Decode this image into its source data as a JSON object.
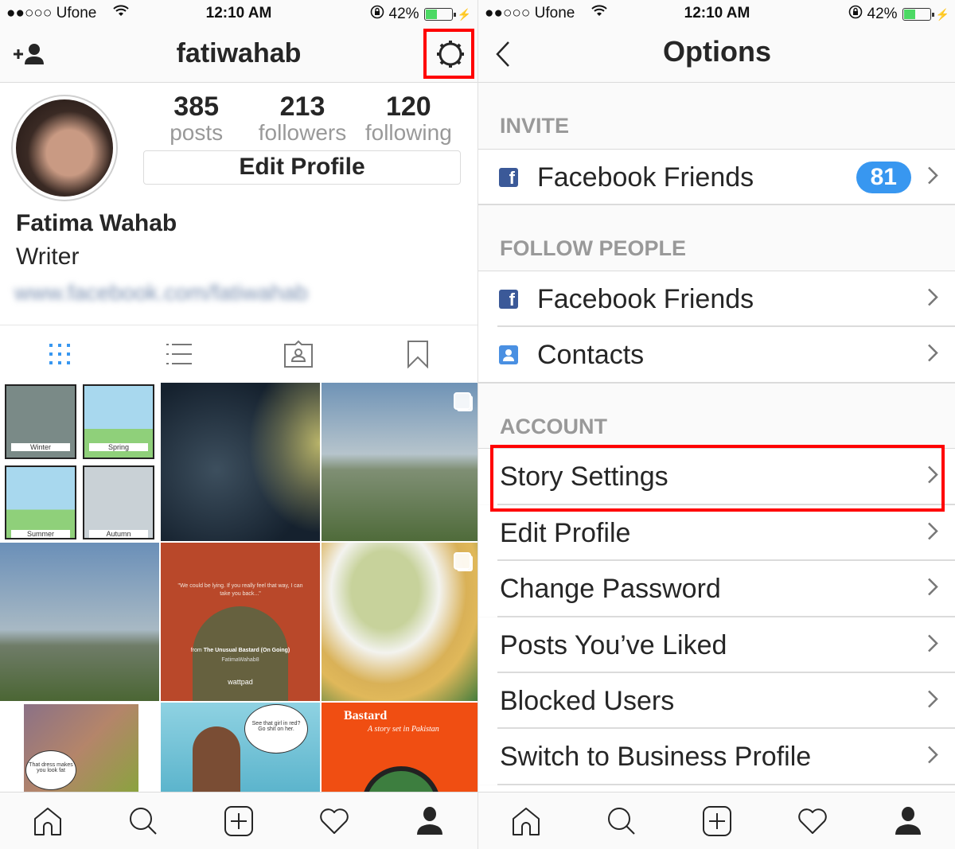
{
  "status_bar": {
    "carrier": "●●○○○ Ufone",
    "time": "12:10 AM",
    "battery": "42%"
  },
  "left": {
    "header": {
      "username": "fatiwahab",
      "add_user_icon": "add-person-icon",
      "settings_icon": "gear-icon"
    },
    "stats": [
      {
        "count": "385",
        "label": "posts"
      },
      {
        "count": "213",
        "label": "followers"
      },
      {
        "count": "120",
        "label": "following"
      }
    ],
    "edit_profile_label": "Edit Profile",
    "full_name": "Fatima Wahab",
    "bio": "Writer",
    "website": "www.facebook.com/fatiwahab",
    "view_tabs": [
      "grid-icon",
      "list-icon",
      "tagged-icon",
      "saved-icon"
    ],
    "grid_tiles": [
      {
        "type": "comic",
        "captions": [
          "Winter",
          "Spring",
          "Summer",
          "Autumn"
        ]
      },
      {
        "type": "photo",
        "description": "night sky tree"
      },
      {
        "type": "photo",
        "description": "city landscape",
        "multi": true
      },
      {
        "type": "photo",
        "description": "city landscape view"
      },
      {
        "type": "quote",
        "text": "\"We could be lying. If you really feel that way, I can take you back...\"",
        "from_label": "from",
        "source": "The Unusual Bastard (On Going)",
        "author": "FatimaWahab8",
        "brand": "wattpad"
      },
      {
        "type": "photo",
        "description": "fries and salad plate",
        "multi": true
      },
      {
        "type": "comic",
        "bubble": "That dress makes you look fat"
      },
      {
        "type": "comic",
        "bubble": "See that girl in red? Go shit on her."
      },
      {
        "type": "cover",
        "title": "Bastard",
        "subtitle": "A story set in Pakistan"
      }
    ]
  },
  "right": {
    "header": {
      "title": "Options",
      "back_icon": "chevron-left-icon"
    },
    "sections": [
      {
        "header": "INVITE",
        "items": [
          {
            "label": "Facebook Friends",
            "icon": "facebook-icon",
            "badge": "81"
          }
        ]
      },
      {
        "header": "FOLLOW PEOPLE",
        "items": [
          {
            "label": "Facebook Friends",
            "icon": "facebook-icon"
          },
          {
            "label": "Contacts",
            "icon": "contacts-icon"
          }
        ]
      },
      {
        "header": "ACCOUNT",
        "items": [
          {
            "label": "Story Settings",
            "highlighted": true
          },
          {
            "label": "Edit Profile"
          },
          {
            "label": "Change Password"
          },
          {
            "label": "Posts You’ve Liked"
          },
          {
            "label": "Blocked Users"
          },
          {
            "label": "Switch to Business Profile"
          }
        ]
      }
    ]
  },
  "tab_bar": [
    "home-icon",
    "search-icon",
    "add-post-icon",
    "activity-heart-icon",
    "profile-icon"
  ],
  "colors": {
    "highlight": "#ff0000",
    "badge": "#3897f0",
    "facebook": "#3b5998",
    "active_tab": "#3897f0"
  }
}
